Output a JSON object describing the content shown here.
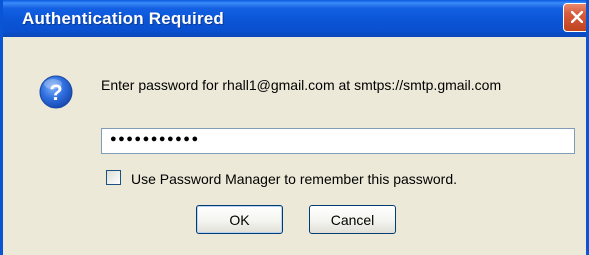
{
  "window": {
    "title": "Authentication Required"
  },
  "dialog": {
    "message": "Enter password for rhall1@gmail.com at smtps://smtp.gmail.com",
    "password_masked": "●●●●●●●●●●●",
    "remember_checkbox": {
      "label": "Use Password Manager to remember this password.",
      "checked": false
    }
  },
  "buttons": {
    "ok": "OK",
    "cancel": "Cancel"
  },
  "icons": {
    "question": "question-icon",
    "close": "close-icon"
  },
  "colors": {
    "titlebar": "#0a55d6",
    "close_button": "#d75d3e",
    "dialog_bg": "#ece9d8",
    "input_border": "#7f9db9",
    "button_border": "#003c74"
  }
}
